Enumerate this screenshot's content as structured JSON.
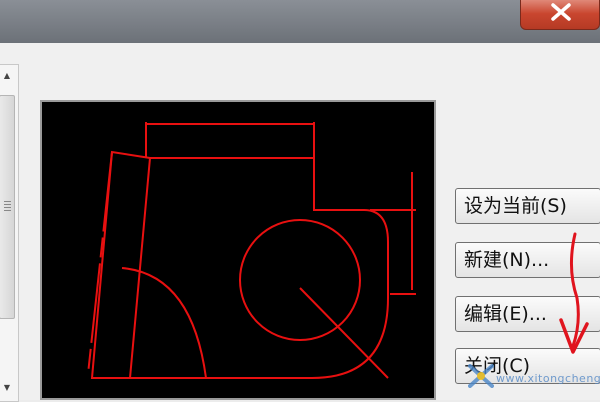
{
  "titlebar": {
    "close_glyph": "X"
  },
  "scrollbar": {
    "up_icon": "arrow-up-icon",
    "down_icon": "arrow-down-icon"
  },
  "preview": {
    "description_icon": "cad-drawing-preview"
  },
  "buttons": {
    "set_current": "设为当前(S)",
    "new": "新建(N)...",
    "edit": "编辑(E)...",
    "close": "关闭(C)"
  },
  "watermark": {
    "text": "www.xitongcheng.com"
  },
  "colors": {
    "drawing": "#e81010",
    "annotation": "#e0141e",
    "close_button": "#c9462f",
    "preview_background": "#000000"
  }
}
